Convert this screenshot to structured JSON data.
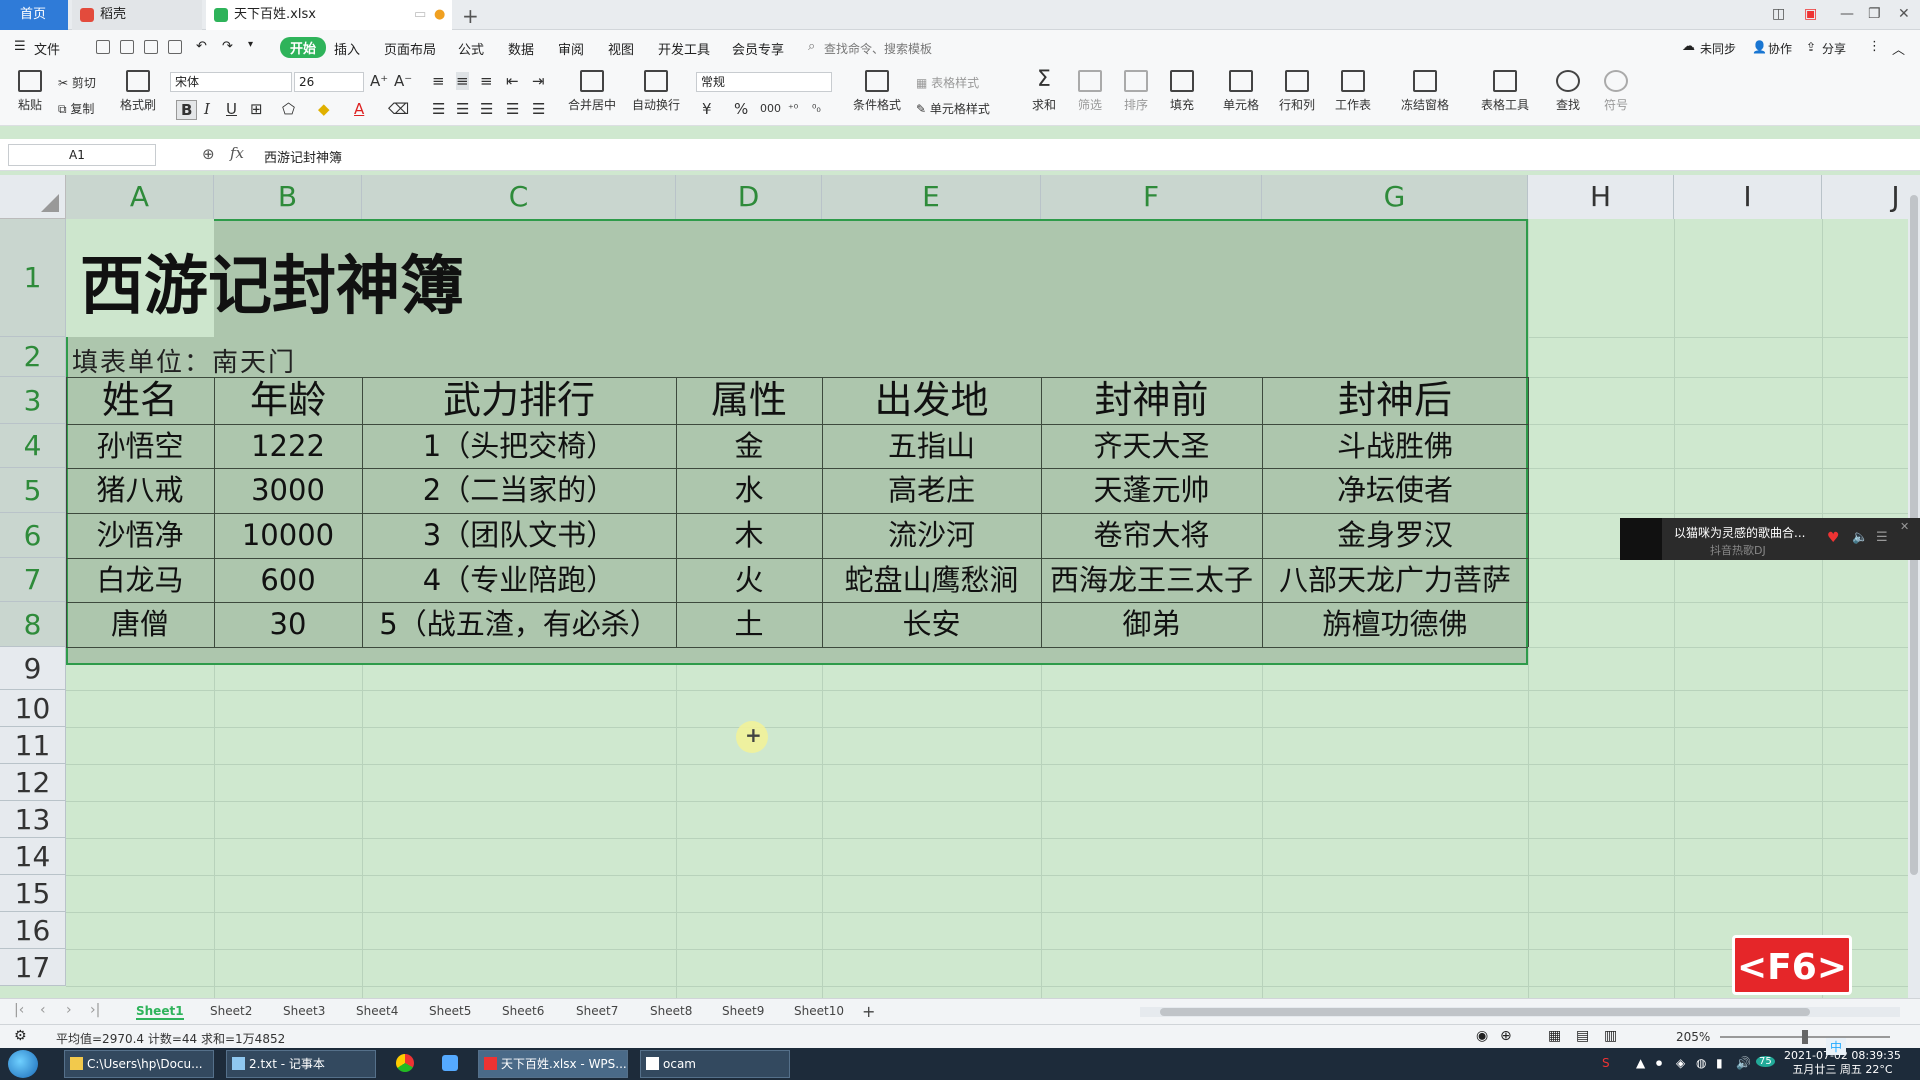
{
  "tabs": {
    "home": "首页",
    "daoke": "稻壳",
    "file": "天下百姓.xlsx",
    "add": "+"
  },
  "menu": {
    "file": "文件",
    "start": "开始",
    "insert": "插入",
    "layout": "页面布局",
    "formula": "公式",
    "data": "数据",
    "review": "审阅",
    "view": "视图",
    "dev": "开发工具",
    "member": "会员专享",
    "search": "查找命令、搜索模板",
    "sync": "未同步",
    "collab": "协作",
    "share": "分享"
  },
  "ribbon": {
    "paste": "粘贴",
    "cut": "剪切",
    "copy": "复制",
    "format_painter": "格式刷",
    "font": "宋体",
    "font_size": "26",
    "bold": "B",
    "italic": "I",
    "underline": "U",
    "merge": "合并居中",
    "wrap": "自动换行",
    "numfmt": "常规",
    "cond_format": "条件格式",
    "table_style": "表格样式",
    "cell_style": "单元格样式",
    "sum": "求和",
    "filter": "筛选",
    "sort": "排序",
    "fill": "填充",
    "cell": "单元格",
    "rowcol": "行和列",
    "worksheet": "工作表",
    "freeze": "冻结窗格",
    "table_tools": "表格工具",
    "find": "查找",
    "symbol": "符号",
    "currency": "¥",
    "percent": "%",
    "thousands": "000"
  },
  "formula_bar": {
    "name_box": "A1",
    "fx": "fx",
    "content": "西游记封神簿"
  },
  "columns": [
    "A",
    "B",
    "C",
    "D",
    "E",
    "F",
    "G",
    "H",
    "I",
    "J"
  ],
  "rows": [
    "1",
    "2",
    "3",
    "4",
    "5",
    "6",
    "7",
    "8",
    "9",
    "10",
    "11",
    "12",
    "13",
    "14",
    "15",
    "16",
    "17"
  ],
  "sheet": {
    "title": "西游记封神簿",
    "unit": "填表单位：南天门",
    "headers": [
      "姓名",
      "年龄",
      "武力排行",
      "属性",
      "出发地",
      "封神前",
      "封神后"
    ],
    "data": [
      [
        "孙悟空",
        "1222",
        "1（头把交椅）",
        "金",
        "五指山",
        "齐天大圣",
        "斗战胜佛"
      ],
      [
        "猪八戒",
        "3000",
        "2（二当家的）",
        "水",
        "高老庄",
        "天蓬元帅",
        "净坛使者"
      ],
      [
        "沙悟净",
        "10000",
        "3（团队文书）",
        "木",
        "流沙河",
        "卷帘大将",
        "金身罗汉"
      ],
      [
        "白龙马",
        "600",
        "4（专业陪跑）",
        "火",
        "蛇盘山鹰愁涧",
        "西海龙王三太子",
        "八部天龙广力菩萨"
      ],
      [
        "唐僧",
        "30",
        "5（战五渣，有必杀）",
        "土",
        "长安",
        "御弟",
        "旃檀功德佛"
      ]
    ]
  },
  "sheet_tabs": [
    "Sheet1",
    "Sheet2",
    "Sheet3",
    "Sheet4",
    "Sheet5",
    "Sheet6",
    "Sheet7",
    "Sheet8",
    "Sheet9",
    "Sheet10"
  ],
  "status": {
    "stats": "平均值=2970.4  计数=44  求和=1万4852",
    "zoom": "205%"
  },
  "popup": {
    "title": "以猫咪为灵感的歌曲合...",
    "sub": "抖音热歌DJ"
  },
  "badge": "<F6>",
  "taskbar": {
    "explorer": "C:\\Users\\hp\\Docu...",
    "notepad": "2.txt - 记事本",
    "wps": "天下百姓.xlsx - WPS...",
    "ocam": "ocam",
    "clock_time": "2021-07-02 08:39:35",
    "clock_date": "五月廿三 周五 22°C",
    "ime": "中",
    "badge_num": "75"
  },
  "colors": {
    "accent": "#2eb35a",
    "sheet_bg": "#cfe8cf",
    "selection": "#adc6ad",
    "badge": "#e52629"
  }
}
